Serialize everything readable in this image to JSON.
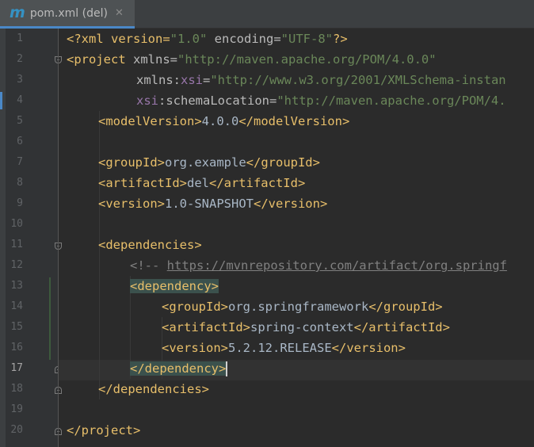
{
  "tab": {
    "icon_letter": "m",
    "icon": "maven-file-icon",
    "title": "pom.xml (del)",
    "close_glyph": "✕"
  },
  "editor": {
    "current_line": "17",
    "line_numbers": [
      "1",
      "2",
      "3",
      "4",
      "5",
      "6",
      "7",
      "8",
      "9",
      "10",
      "11",
      "12",
      "13",
      "14",
      "15",
      "16",
      "17",
      "18",
      "19",
      "20"
    ],
    "lines": [
      [
        "<?xml version=",
        "\"1.0\"",
        " encoding=",
        "\"UTF-8\"",
        "?>"
      ],
      [
        "<project",
        " xmlns=",
        "\"http://maven.apache.org/POM/4.0.0\""
      ],
      [
        "xmlns:",
        "xsi",
        "=",
        "\"http://www.w3.org/2001/XMLSchema-instan"
      ],
      [
        "xsi",
        ":schemaLocation=",
        "\"http://maven.apache.org/POM/4."
      ],
      [
        "<modelVersion>",
        "4.0.0",
        "</modelVersion>"
      ],
      [],
      [
        "<groupId>",
        "org.example",
        "</groupId>"
      ],
      [
        "<artifactId>",
        "del",
        "</artifactId>"
      ],
      [
        "<version>",
        "1.0-SNAPSHOT",
        "</version>"
      ],
      [],
      [
        "<dependencies>"
      ],
      [
        "<!-- ",
        "https://mvnrepository.com/artifact/org.springf"
      ],
      [
        "<dependency>"
      ],
      [
        "<groupId>",
        "org.springframework",
        "</groupId>"
      ],
      [
        "<artifactId>",
        "spring-context",
        "</artifactId>"
      ],
      [
        "<version>",
        "5.2.12.RELEASE",
        "</version>"
      ],
      [
        "</dependency>"
      ],
      [
        "</dependencies>"
      ],
      [],
      [
        "</project>"
      ]
    ]
  }
}
